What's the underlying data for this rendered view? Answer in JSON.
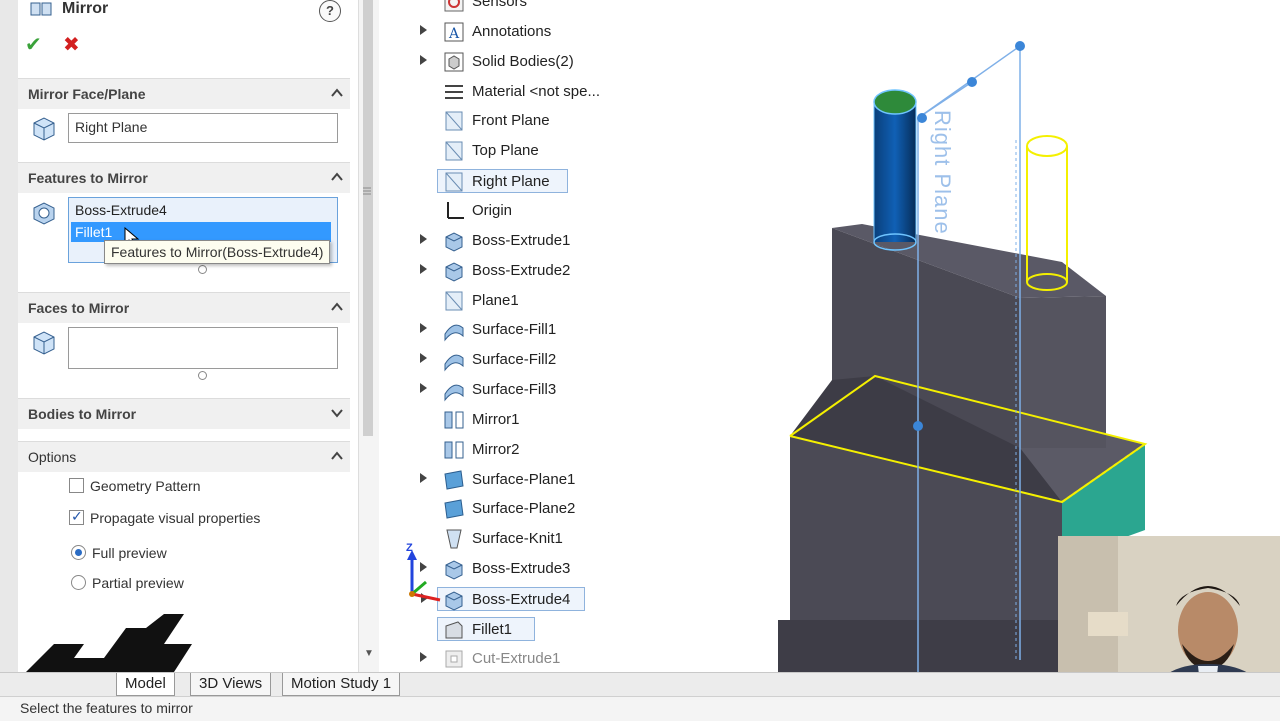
{
  "property_manager": {
    "title": "Mirror",
    "help": "?",
    "ok": "✔",
    "cancel": "✖",
    "mirror_face": {
      "label": "Mirror Face/Plane",
      "value": "Right Plane"
    },
    "features": {
      "label": "Features to Mirror",
      "items": [
        {
          "label": "Boss-Extrude4",
          "selected": false
        },
        {
          "label": "Fillet1",
          "selected": true
        }
      ],
      "tooltip": "Features to Mirror(Boss-Extrude4)"
    },
    "faces": {
      "label": "Faces to Mirror",
      "value": ""
    },
    "bodies": {
      "label": "Bodies to Mirror"
    },
    "options": {
      "label": "Options",
      "geometry_pattern": {
        "label": "Geometry Pattern",
        "checked": false
      },
      "propagate": {
        "label": "Propagate visual properties",
        "checked": true
      },
      "full_preview": {
        "label": "Full preview",
        "selected": true
      },
      "partial_preview": {
        "label": "Partial preview",
        "selected": false
      }
    }
  },
  "tree": {
    "items": [
      {
        "label": "Sensors",
        "expandable": false
      },
      {
        "label": "Annotations",
        "expandable": true
      },
      {
        "label": "Solid Bodies(2)",
        "expandable": true
      },
      {
        "label": "Material <not spe...",
        "expandable": false
      },
      {
        "label": "Front Plane",
        "expandable": false
      },
      {
        "label": "Top Plane",
        "expandable": false
      },
      {
        "label": "Right Plane",
        "expandable": false,
        "highlighted": true
      },
      {
        "label": "Origin",
        "expandable": false
      },
      {
        "label": "Boss-Extrude1",
        "expandable": true
      },
      {
        "label": "Boss-Extrude2",
        "expandable": true
      },
      {
        "label": "Plane1",
        "expandable": false
      },
      {
        "label": "Surface-Fill1",
        "expandable": true
      },
      {
        "label": "Surface-Fill2",
        "expandable": true
      },
      {
        "label": "Surface-Fill3",
        "expandable": true
      },
      {
        "label": "Mirror1",
        "expandable": false
      },
      {
        "label": "Mirror2",
        "expandable": false
      },
      {
        "label": "Surface-Plane1",
        "expandable": true
      },
      {
        "label": "Surface-Plane2",
        "expandable": false
      },
      {
        "label": "Surface-Knit1",
        "expandable": false
      },
      {
        "label": "Boss-Extrude3",
        "expandable": true
      },
      {
        "label": "Boss-Extrude4",
        "expandable": true,
        "highlighted": true
      },
      {
        "label": "Fillet1",
        "expandable": false,
        "highlighted": true
      },
      {
        "label": "Cut-Extrude1",
        "expandable": true,
        "dimmed": true
      }
    ]
  },
  "viewport": {
    "plane_label": "Right Plane",
    "triad_axis": "Z"
  },
  "tabs": [
    {
      "label": "Model",
      "active": true
    },
    {
      "label": "3D Views",
      "active": false
    },
    {
      "label": "Motion Study 1",
      "active": false
    }
  ],
  "status": {
    "text": "Select the features to mirror"
  },
  "colors": {
    "selection": "#3399ff",
    "preview_yellow": "#f4f000",
    "plane_blue": "#9dc0ea",
    "body_dark": "#4a4a54",
    "face_teal": "#2aa890"
  }
}
